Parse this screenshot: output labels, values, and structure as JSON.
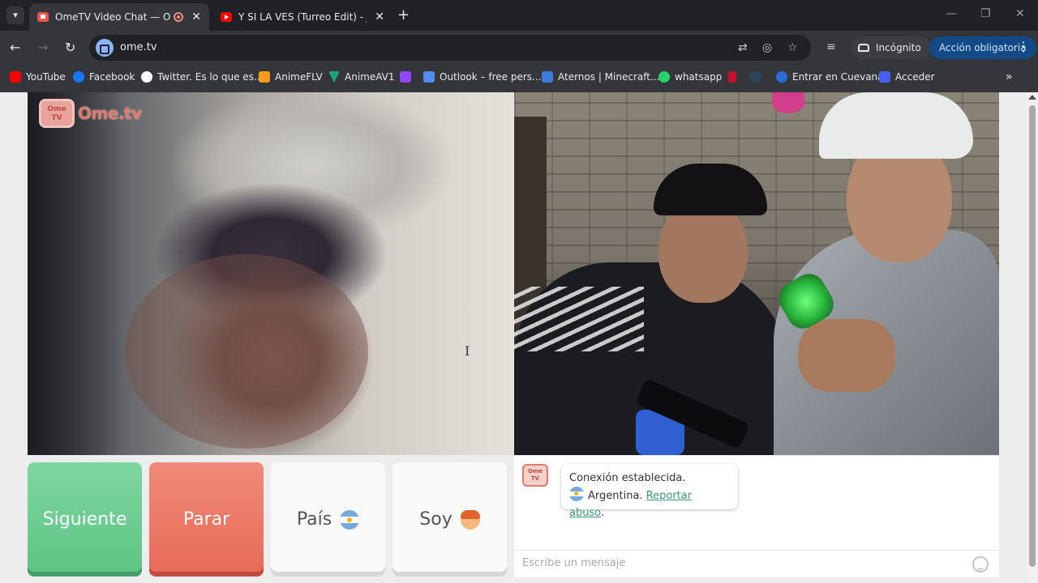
{
  "browser": {
    "tabs": [
      {
        "title": "OmeTV Video Chat — Ome",
        "active": true
      },
      {
        "title": "Y SI LA VES (Turreo Edit) - Jona",
        "active": false
      }
    ],
    "new_tab_symbol": "+",
    "close_symbol": "✕",
    "url": "ome.tv",
    "incognito_label": "Incógnito",
    "action_label": "Acción obligatoria"
  },
  "bookmarks": [
    {
      "label": "YouTube",
      "color": "#ff0000"
    },
    {
      "label": "Facebook",
      "color": "#1877f2"
    },
    {
      "label": "Twitter. Es lo que es...",
      "color": "#ffffff"
    },
    {
      "label": "AnimeFLV",
      "color": "#f29b1d"
    },
    {
      "label": "AnimeAV1",
      "color": "#1fa37a"
    },
    {
      "label": "",
      "color": "#9146ff"
    },
    {
      "label": "Outlook – free pers...",
      "color": "#4f8bf0"
    },
    {
      "label": "Aternos | Minecraft...",
      "color": "#3b7ddd"
    },
    {
      "label": "whatsapp",
      "color": "#25d366"
    },
    {
      "label": "",
      "color": "#c8102e"
    },
    {
      "label": "",
      "color": "#2a475e"
    },
    {
      "label": "Entrar en Cuevana",
      "color": "#2b6bd8"
    },
    {
      "label": "Acceder",
      "color": "#4a5ff0"
    }
  ],
  "page": {
    "logo_text": "Ome.tv",
    "logo_badge": "Ome TV",
    "buttons": {
      "next": "Siguiente",
      "stop": "Parar",
      "country": "País",
      "me": "Soy"
    },
    "chat": {
      "status": "Conexión establecida.",
      "country": "Argentina.",
      "report": "Reportar abuso",
      "report_suffix": ".",
      "placeholder": "Escribe un mensaje"
    }
  },
  "colors": {
    "next_button": "#5cc484",
    "stop_button": "#e66a57",
    "report_link": "#3a9c74",
    "action_button": "#124a87"
  }
}
